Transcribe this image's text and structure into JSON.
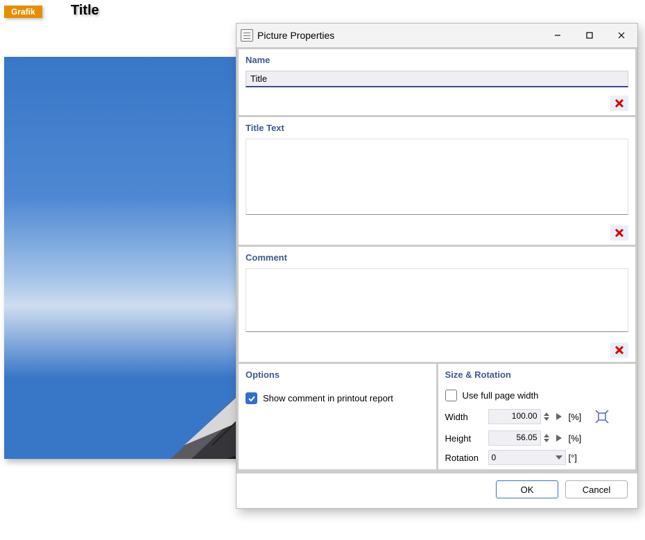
{
  "background": {
    "badge": "Grafik",
    "title": "Title"
  },
  "dialog": {
    "title": "Picture Properties",
    "sections": {
      "name": {
        "label": "Name",
        "value": "Title"
      },
      "titleText": {
        "label": "Title Text",
        "value": ""
      },
      "comment": {
        "label": "Comment",
        "value": ""
      },
      "options": {
        "label": "Options",
        "showComment": {
          "label": "Show comment in printout report",
          "checked": true
        }
      },
      "sizeRotation": {
        "label": "Size & Rotation",
        "fullWidth": {
          "label": "Use full page width",
          "checked": false
        },
        "widthLabel": "Width",
        "widthValue": "100.00",
        "widthUnit": "[%]",
        "heightLabel": "Height",
        "heightValue": "56.05",
        "heightUnit": "[%]",
        "rotationLabel": "Rotation",
        "rotationValue": "0",
        "rotationUnit": "[°]"
      }
    },
    "buttons": {
      "ok": "OK",
      "cancel": "Cancel"
    }
  }
}
